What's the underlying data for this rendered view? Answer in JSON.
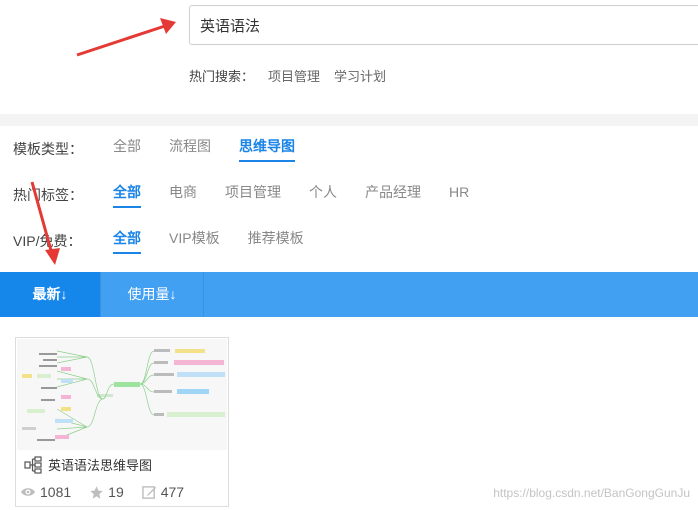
{
  "search": {
    "value": "英语语法"
  },
  "hot_search": {
    "label": "热门搜索：",
    "items": [
      "项目管理",
      "学习计划"
    ]
  },
  "filters": {
    "template_type": {
      "label": "模板类型：",
      "items": [
        "全部",
        "流程图",
        "思维导图"
      ]
    },
    "hot_tags": {
      "label": "热门标签：",
      "items": [
        "全部",
        "电商",
        "项目管理",
        "个人",
        "产品经理",
        "HR"
      ]
    },
    "vip_free": {
      "label": "VIP/免费：",
      "items": [
        "全部",
        "VIP模板",
        "推荐模板"
      ]
    }
  },
  "sort": {
    "latest": "最新↓",
    "usage": "使用量↓"
  },
  "card": {
    "title": "英语语法思维导图",
    "views": "1081",
    "stars": "19",
    "edits": "477"
  },
  "watermark": "https://blog.csdn.net/BanGongGunJu",
  "colors": {
    "accent": "#1a84e8",
    "sort_bar": "#42a0f3",
    "annotation_arrow": "#e53935"
  },
  "icons": [
    "eye-icon",
    "star-icon",
    "edit-icon",
    "mindmap-icon"
  ]
}
